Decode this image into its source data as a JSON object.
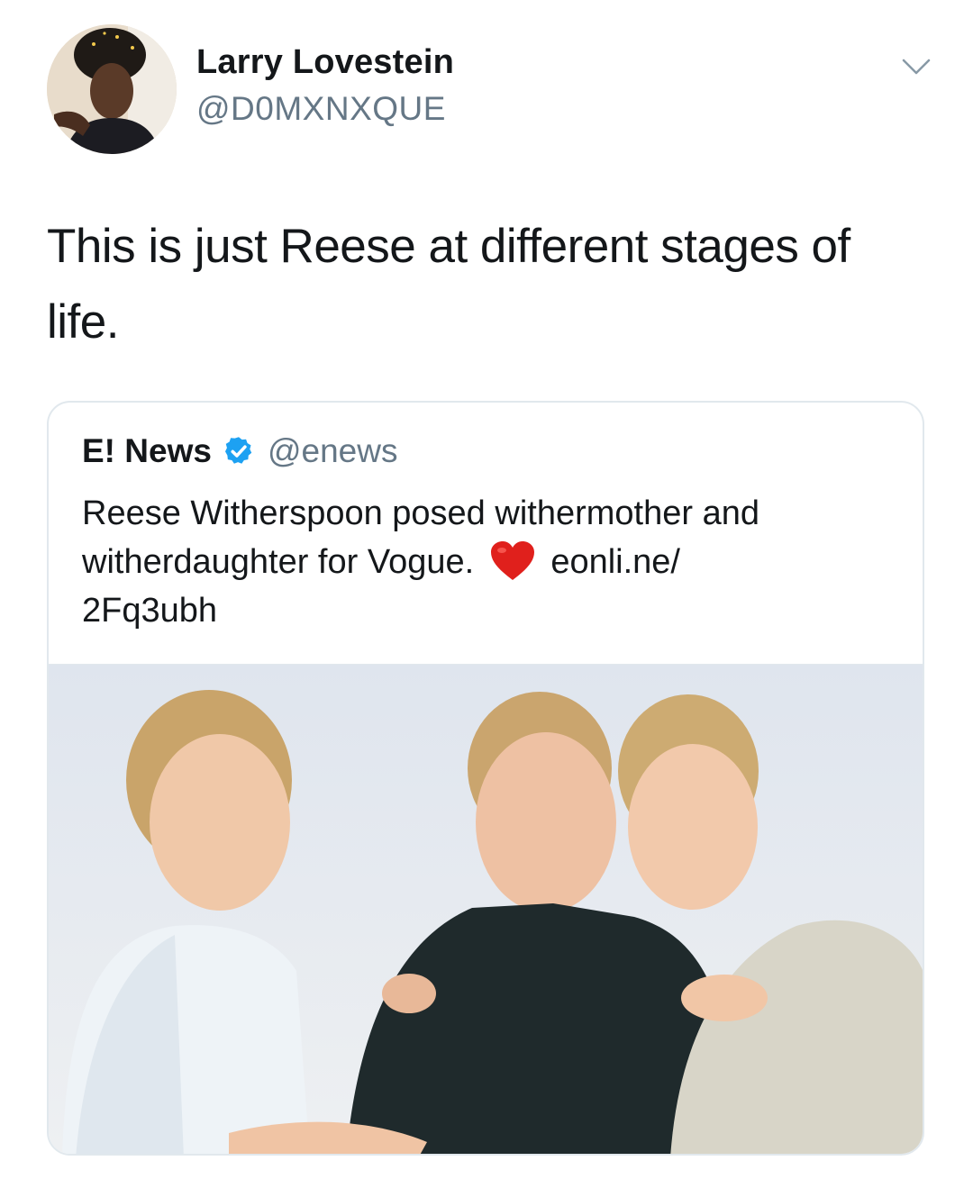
{
  "tweet": {
    "author_name": "Larry Lovestein",
    "author_handle": "@D0MXNXQUE",
    "text_line1": "This is just Reese at different stages of",
    "text_line2": "life.",
    "menu_icon": "chevron-down-icon"
  },
  "quoted_tweet": {
    "author_name": "E! News",
    "author_handle": "@enews",
    "verified": true,
    "verified_icon": "verified-badge-icon",
    "text_line1": "Reese Witherspoon posed withermother and",
    "text_line2_a": "witherdaughter for Vogue.",
    "emoji": "red-heart-icon",
    "text_line2_b": "eonli.ne/",
    "text_line3": "2Fq3ubh",
    "media": "photo"
  },
  "colors": {
    "text": "#14171a",
    "secondary_text": "#657786",
    "border": "#e1e8ed",
    "verified_blue": "#1da1f2",
    "heart_red": "#e0201c"
  }
}
